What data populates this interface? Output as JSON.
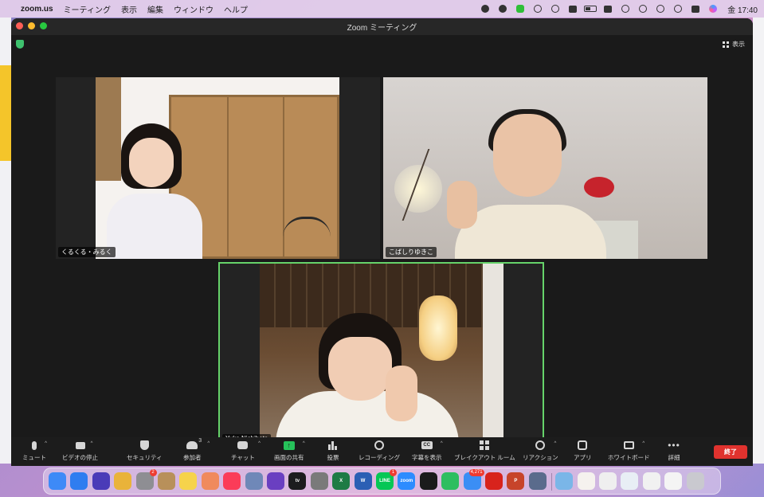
{
  "menubar": {
    "app_name": "zoom.us",
    "items": [
      "ミーティング",
      "表示",
      "編集",
      "ウィンドウ",
      "ヘルプ"
    ],
    "clock": "金 17:40",
    "tray_icons": [
      "creative-cloud-icon",
      "dash-icon",
      "line-icon",
      "cloud-icon",
      "play-icon",
      "volume-icon",
      "battery-icon",
      "input-method-icon",
      "wifi-icon",
      "user-icon",
      "time-machine-icon",
      "search-icon",
      "control-center-icon",
      "siri-icon"
    ]
  },
  "window": {
    "title": "Zoom ミーティング",
    "view_button": "表示"
  },
  "participants": [
    {
      "name": "くるくる・みるく",
      "active": false
    },
    {
      "name": "こばしりゆきこ",
      "active": false
    },
    {
      "name": "Yuka Nishihata",
      "active": true
    }
  ],
  "toolbar": {
    "items": [
      {
        "label": "ミュート",
        "icon": "microphone-icon",
        "caret": "^"
      },
      {
        "label": "ビデオの停止",
        "icon": "video-camera-icon",
        "caret": "^"
      },
      {
        "label": "セキュリティ",
        "icon": "shield-icon"
      },
      {
        "label": "参加者",
        "icon": "participants-icon",
        "count": "3",
        "caret": "^"
      },
      {
        "label": "チャット",
        "icon": "chat-icon",
        "caret": "^"
      },
      {
        "label": "画面の共有",
        "icon": "share-screen-icon",
        "caret": "^",
        "accent": "#26c15a"
      },
      {
        "label": "投票",
        "icon": "polls-icon"
      },
      {
        "label": "レコーディング",
        "icon": "record-icon"
      },
      {
        "label": "字幕を表示",
        "icon": "captions-icon",
        "icon_text": "CC",
        "caret": "^"
      },
      {
        "label": "ブレイクアウト ルーム",
        "icon": "breakout-rooms-icon"
      },
      {
        "label": "リアクション",
        "icon": "reaction-icon",
        "caret": "^"
      },
      {
        "label": "アプリ",
        "icon": "apps-icon"
      },
      {
        "label": "ホワイトボード",
        "icon": "whiteboard-icon",
        "caret": "^"
      },
      {
        "label": "詳細",
        "icon": "more-icon",
        "icon_text": "•••"
      }
    ],
    "end_label": "終了",
    "end_color": "#e0322e"
  },
  "dock": {
    "apps": [
      {
        "name": "finder-icon",
        "color": "#3d8af7"
      },
      {
        "name": "safari-icon",
        "color": "#2f7df0"
      },
      {
        "name": "siri-app-icon",
        "color": "#4a3bb8"
      },
      {
        "name": "chrome-icon",
        "color": "#e9b33a"
      },
      {
        "name": "system-preferences-icon",
        "color": "#8e8e93",
        "badge": "2"
      },
      {
        "name": "keychain-icon",
        "color": "#b8905a"
      },
      {
        "name": "notes-icon",
        "color": "#f6d34b"
      },
      {
        "name": "photos-icon",
        "color": "#f08a5d"
      },
      {
        "name": "music-icon",
        "color": "#fb3c58"
      },
      {
        "name": "preview-icon",
        "color": "#6f88b8"
      },
      {
        "name": "imovie-icon",
        "color": "#6a3fc1"
      },
      {
        "name": "apple-tv-icon",
        "color": "#1c1c1e",
        "text": "tv"
      },
      {
        "name": "app-icon",
        "color": "#7a7a7a"
      },
      {
        "name": "excel-icon",
        "color": "#1e7b45",
        "text": "X"
      },
      {
        "name": "word-icon",
        "color": "#2b5fb4",
        "text": "W"
      },
      {
        "name": "line-app-icon",
        "color": "#06c755",
        "text": "LINE",
        "badge": "1"
      },
      {
        "name": "zoom-icon",
        "color": "#2d8cff",
        "text": "zoom"
      },
      {
        "name": "kindle-icon",
        "color": "#1b1b1b"
      },
      {
        "name": "evernote-icon",
        "color": "#2dbe60"
      },
      {
        "name": "mail-icon",
        "color": "#3b8ef5",
        "badge": "4,271"
      },
      {
        "name": "acrobat-icon",
        "color": "#d8231c"
      },
      {
        "name": "powerpoint-icon",
        "color": "#c7442a",
        "text": "P"
      },
      {
        "name": "screenshot-icon",
        "color": "#5a6b8c"
      },
      {
        "name": "downloads-folder-icon",
        "color": "#7ab6e8"
      },
      {
        "name": "document-thumb-1-icon",
        "color": "#f5f2ee"
      },
      {
        "name": "document-thumb-2-icon",
        "color": "#efefef"
      },
      {
        "name": "document-thumb-3-icon",
        "color": "#e8eef5"
      },
      {
        "name": "document-thumb-4-icon",
        "color": "#f1f1f1"
      },
      {
        "name": "document-thumb-5-icon",
        "color": "#f4f4f4"
      },
      {
        "name": "trash-icon",
        "color": "#c9c9cf"
      }
    ]
  }
}
